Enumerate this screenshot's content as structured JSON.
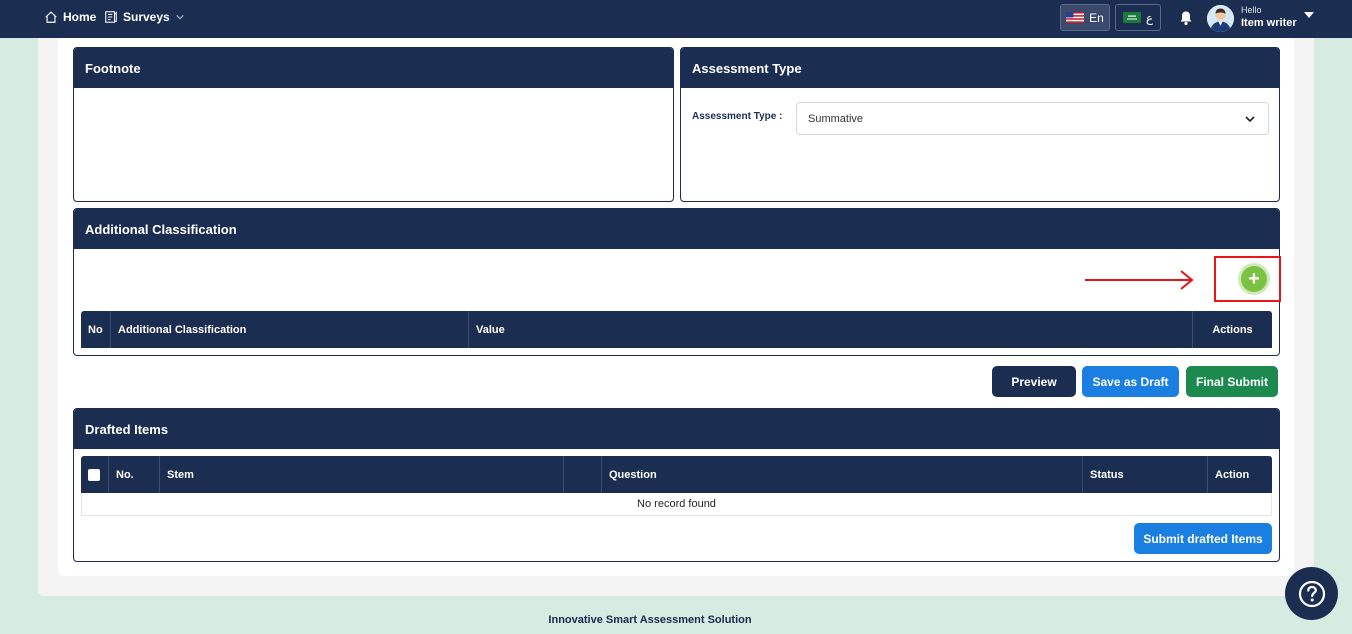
{
  "topbar": {
    "home_label": "Home",
    "surveys_label": "Surveys",
    "lang_en": "En",
    "lang_ar": "ع",
    "hello": "Hello",
    "user_name": "Item writer"
  },
  "footnote": {
    "title": "Footnote"
  },
  "assessment_type": {
    "title": "Assessment Type",
    "label": "Assessment Type :",
    "selected": "Summative"
  },
  "additional_classification": {
    "title": "Additional Classification",
    "columns": [
      "No",
      "Additional Classification",
      "Value",
      "Actions"
    ]
  },
  "actions": {
    "preview": "Preview",
    "save_draft": "Save as Draft",
    "final_submit": "Final Submit"
  },
  "drafted_items": {
    "title": "Drafted Items",
    "columns": [
      "No.",
      "Stem",
      "Question",
      "Status",
      "Action"
    ],
    "empty_text": "No record found",
    "submit_label": "Submit drafted Items"
  },
  "footer": {
    "text": "Innovative Smart Assessment Solution"
  },
  "colors": {
    "navy": "#1c2d52",
    "blue": "#1a7fe0",
    "green": "#1c8a4e",
    "add_green": "#7bc142",
    "highlight_red": "#e8151b",
    "background_mint": "#d6ebe1"
  }
}
